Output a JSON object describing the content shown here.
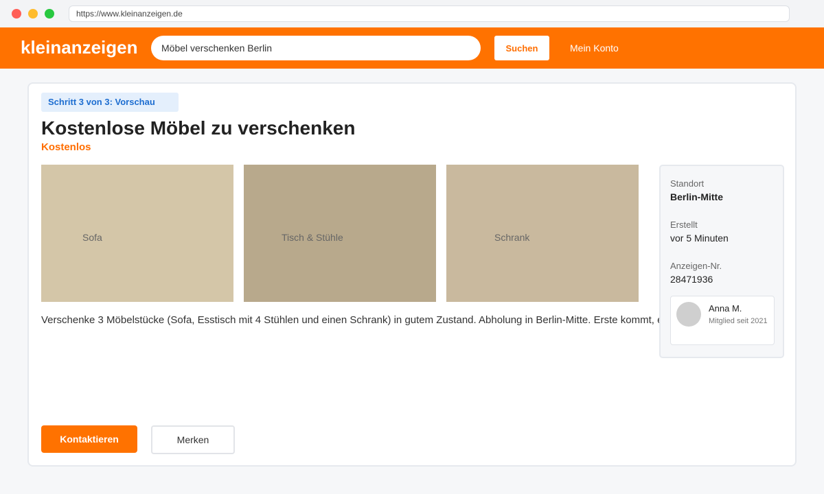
{
  "browser": {
    "url": "https://www.kleinanzeigen.de"
  },
  "header": {
    "logo": "kleinanzeigen",
    "search_value": "Möbel verschenken Berlin",
    "search_button": "Suchen",
    "account_link": "Mein Konto"
  },
  "listing": {
    "step": "Schritt 3 von 3: Vorschau",
    "title": "Kostenlose Möbel zu verschenken",
    "price": "Kostenlos",
    "photos": [
      {
        "label": "Sofa",
        "color": "#d4c6a8"
      },
      {
        "label": "Tisch & Stühle",
        "color": "#b8a98c"
      },
      {
        "label": "Schrank",
        "color": "#c9b99e"
      }
    ],
    "description": "Verschenke 3 Möbelstücke (Sofa, Esstisch mit 4 Stühlen und einen Schrank) in gutem Zustand. Abholung in Berlin-Mitte. Erste kommt, erste mahlt."
  },
  "sidebar": {
    "location_label": "Standort",
    "location_value": "Berlin-Mitte",
    "created_label": "Erstellt",
    "created_value": "vor 5 Minuten",
    "ad_number_label": "Anzeigen-Nr.",
    "ad_number_value": "28471936",
    "seller": {
      "name": "Anna M.",
      "member_since": "Mitglied seit 2021"
    }
  },
  "actions": {
    "contact_button": "Kontaktieren",
    "save_button": "Merken"
  },
  "colors": {
    "brand_orange": "#ff7200",
    "step_blue": "#1d6dd0"
  }
}
